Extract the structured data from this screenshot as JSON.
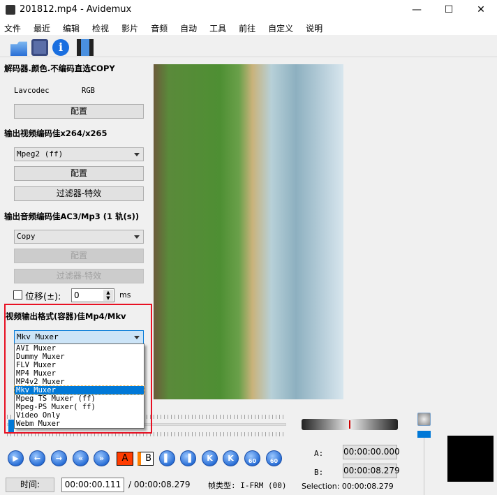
{
  "window": {
    "title": "201812.mp4 - Avidemux",
    "minimize": "—",
    "maximize": "☐",
    "close": "✕"
  },
  "menu": [
    "文件",
    "最近",
    "编辑",
    "检视",
    "影片",
    "音频",
    "自动",
    "工具",
    "前往",
    "自定义",
    "说明"
  ],
  "toolbar": [
    "open-icon",
    "save-icon",
    "info-icon",
    "filter-icon"
  ],
  "decoder": {
    "heading": "解码器.颜色.不编码直选COPY",
    "codec": "Lavcodec",
    "color": "RGB",
    "configure": "配置"
  },
  "video_out": {
    "heading": "输出视频编码佳x264/x265",
    "selected": "Mpeg2 (ff)",
    "configure": "配置",
    "filters": "过滤器-特效"
  },
  "audio_out": {
    "heading": "输出音频编码佳AC3/Mp3 (1 轨(s))",
    "selected": "Copy",
    "configure": "配置",
    "filters": "过滤器-特效",
    "shift_label": "位移(±):",
    "shift_checked": false,
    "shift_value": "0",
    "shift_unit": "ms"
  },
  "muxer": {
    "heading": "视频输出格式(容器)佳Mp4/Mkv",
    "selected": "Mkv Muxer",
    "options": [
      "AVI Muxer",
      "Dummy Muxer",
      "FLV Muxer",
      "MP4 Muxer",
      "MP4v2 Muxer",
      "Mkv Muxer",
      "Mpeg TS Muxer (ff)",
      "Mpeg-PS Muxer( ff)",
      "Video Only",
      "Webm Muxer"
    ]
  },
  "playback": {
    "mark_a": "A",
    "mark_b": "B",
    "goto_label": "60"
  },
  "status": {
    "time_button": "时间:",
    "current_time": "00:00:00.111",
    "total_time": "/ 00:00:08.279",
    "frame_type": "帧类型: I-FRM (00)",
    "a_label": "A:",
    "a_value": "00:00:00.000",
    "b_label": "B:",
    "b_value": "00:00:08.279",
    "selection": "Selection: 00:00:08.279"
  },
  "colors": {
    "accent": "#0078d7",
    "highlight": "#e81123"
  }
}
